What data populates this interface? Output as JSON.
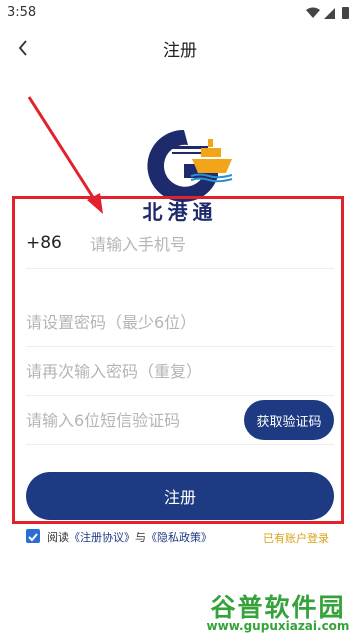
{
  "status_bar": {
    "time": "3:58"
  },
  "nav": {
    "title": "注册"
  },
  "logo": {
    "text": "北港通"
  },
  "form": {
    "phone_prefix": "+86",
    "phone_placeholder": "请输入手机号",
    "password_placeholder": "请设置密码（最少6位）",
    "confirm_placeholder": "请再次输入密码（重复）",
    "code_placeholder": "请输入6位短信验证码",
    "code_button": "获取验证码",
    "register_button": "注册"
  },
  "agreement": {
    "checked": true,
    "prefix": "阅读",
    "terms": "《注册协议》",
    "and": "与",
    "privacy": "《隐私政策》",
    "login_link": "已有账户登录"
  },
  "watermark": {
    "title": "谷普软件园",
    "url": "www.gupuxiazai.com"
  },
  "colors": {
    "primary": "#1e3a82",
    "accent": "#d9a21b",
    "highlight": "#e2222b",
    "watermark": "#35a23a"
  }
}
